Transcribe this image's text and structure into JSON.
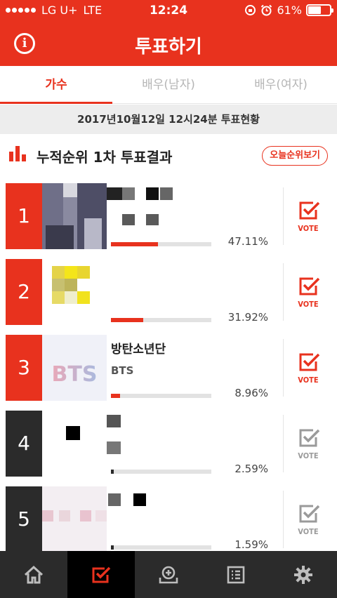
{
  "status_bar": {
    "carrier": "LG U+",
    "network": "LTE",
    "time": "12:24",
    "battery": "61%",
    "battery_level": 0.61
  },
  "header": {
    "title": "투표하기",
    "info_icon": "info-icon"
  },
  "tabs": [
    {
      "label": "가수",
      "active": true
    },
    {
      "label": "배우(남자)",
      "active": false
    },
    {
      "label": "배우(여자)",
      "active": false
    }
  ],
  "date_text": "2017년10월12일 12시24분 투표현황",
  "section": {
    "title": "누적순위 1차 투표결과",
    "today_button": "오늘순위보기"
  },
  "ranks": [
    {
      "rank": "1",
      "name": "",
      "sub": "",
      "percent": "47.11%",
      "share": 0.4711,
      "vote_label": "VOTE",
      "vote_enabled": true
    },
    {
      "rank": "2",
      "name": "",
      "sub": "",
      "percent": "31.92%",
      "share": 0.3192,
      "vote_label": "VOTE",
      "vote_enabled": true
    },
    {
      "rank": "3",
      "name": "방탄소년단",
      "sub": "BTS",
      "logo_text": "BTS",
      "percent": "8.96%",
      "share": 0.0896,
      "vote_label": "VOTE",
      "vote_enabled": true
    },
    {
      "rank": "4",
      "name": "",
      "sub": "",
      "percent": "2.59%",
      "share": 0.0259,
      "vote_label": "VOTE",
      "vote_enabled": false
    },
    {
      "rank": "5",
      "name": "",
      "sub": "",
      "percent": "1.59%",
      "share": 0.0159,
      "vote_label": "VOTE",
      "vote_enabled": false
    }
  ],
  "bottom_nav": [
    {
      "icon": "home-icon",
      "active": false
    },
    {
      "icon": "vote-check-icon",
      "active": true
    },
    {
      "icon": "add-download-icon",
      "active": false
    },
    {
      "icon": "list-icon",
      "active": false
    },
    {
      "icon": "gear-icon",
      "active": false
    }
  ],
  "colors": {
    "brand_red": "#e8321e",
    "dark": "#2b2b2b"
  }
}
